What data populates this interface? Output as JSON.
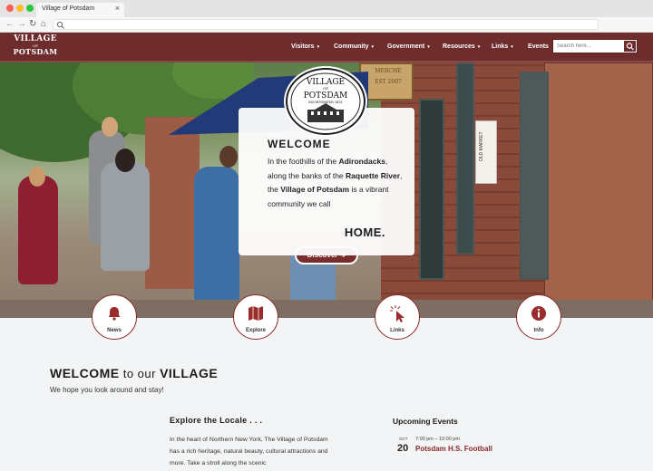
{
  "browser": {
    "tab_title": "Village of Potsdam",
    "tab_close": "×",
    "back": "←",
    "forward": "→",
    "reload": "↻",
    "home": "⌂"
  },
  "header": {
    "logo": {
      "line1": "VILLAGE",
      "line2": "OF",
      "line3": "POTSDAM"
    },
    "nav": [
      {
        "label": "Visitors",
        "caret": "▾"
      },
      {
        "label": "Community",
        "caret": "▾"
      },
      {
        "label": "Government",
        "caret": "▾"
      },
      {
        "label": "Resources",
        "caret": "▾"
      },
      {
        "label": "Links",
        "caret": "▾"
      },
      {
        "label": "Events",
        "caret": ""
      }
    ],
    "search_placeholder": "Search here...",
    "search_icon": "search-icon"
  },
  "hero": {
    "seal": {
      "top": "VILLAGE",
      "of": "OF",
      "name": "POTSDAM",
      "incorporated": "INCORPORATED 1831"
    },
    "sign_lines": [
      "MERCHE",
      "EST 2007"
    ],
    "market_sign": "OLD MARKET",
    "card": {
      "title": "WELCOME",
      "text_parts": [
        "In the foothills of the ",
        "Adirondacks",
        ", along the banks of the ",
        "Raquette River",
        ", the ",
        "Village of Potsdam",
        " is a vibrant community we call"
      ],
      "home": "HOME."
    },
    "discover_label": "Discover",
    "discover_arrow": "➔"
  },
  "quick_links": [
    {
      "label": "News",
      "icon": "bell-icon"
    },
    {
      "label": "Explore",
      "icon": "map-icon"
    },
    {
      "label": "Links",
      "icon": "cursor-click-icon"
    },
    {
      "label": "Info",
      "icon": "info-icon"
    }
  ],
  "content": {
    "welcome_strong": "WELCOME",
    "welcome_soft": " to our ",
    "welcome_strong2": "VILLAGE",
    "welcome_sub": "We hope you look around and stay!",
    "explore_title": "Explore the Locale . . .",
    "explore_text": "In the heart of Northern New York, The Village of Potsdam has a rich heritage, natural beauty, cultural attractions and more. Take a stroll along the scenic",
    "events_title": "Upcoming Events",
    "events": [
      {
        "month": "OCT",
        "day": "20",
        "time": "7:00 pm – 10:00 pm",
        "title": "Potsdam H.S. Football"
      }
    ]
  },
  "colors": {
    "brand": "#6f2c2c",
    "accent": "#8a2b2b",
    "awning": "#223a78"
  }
}
